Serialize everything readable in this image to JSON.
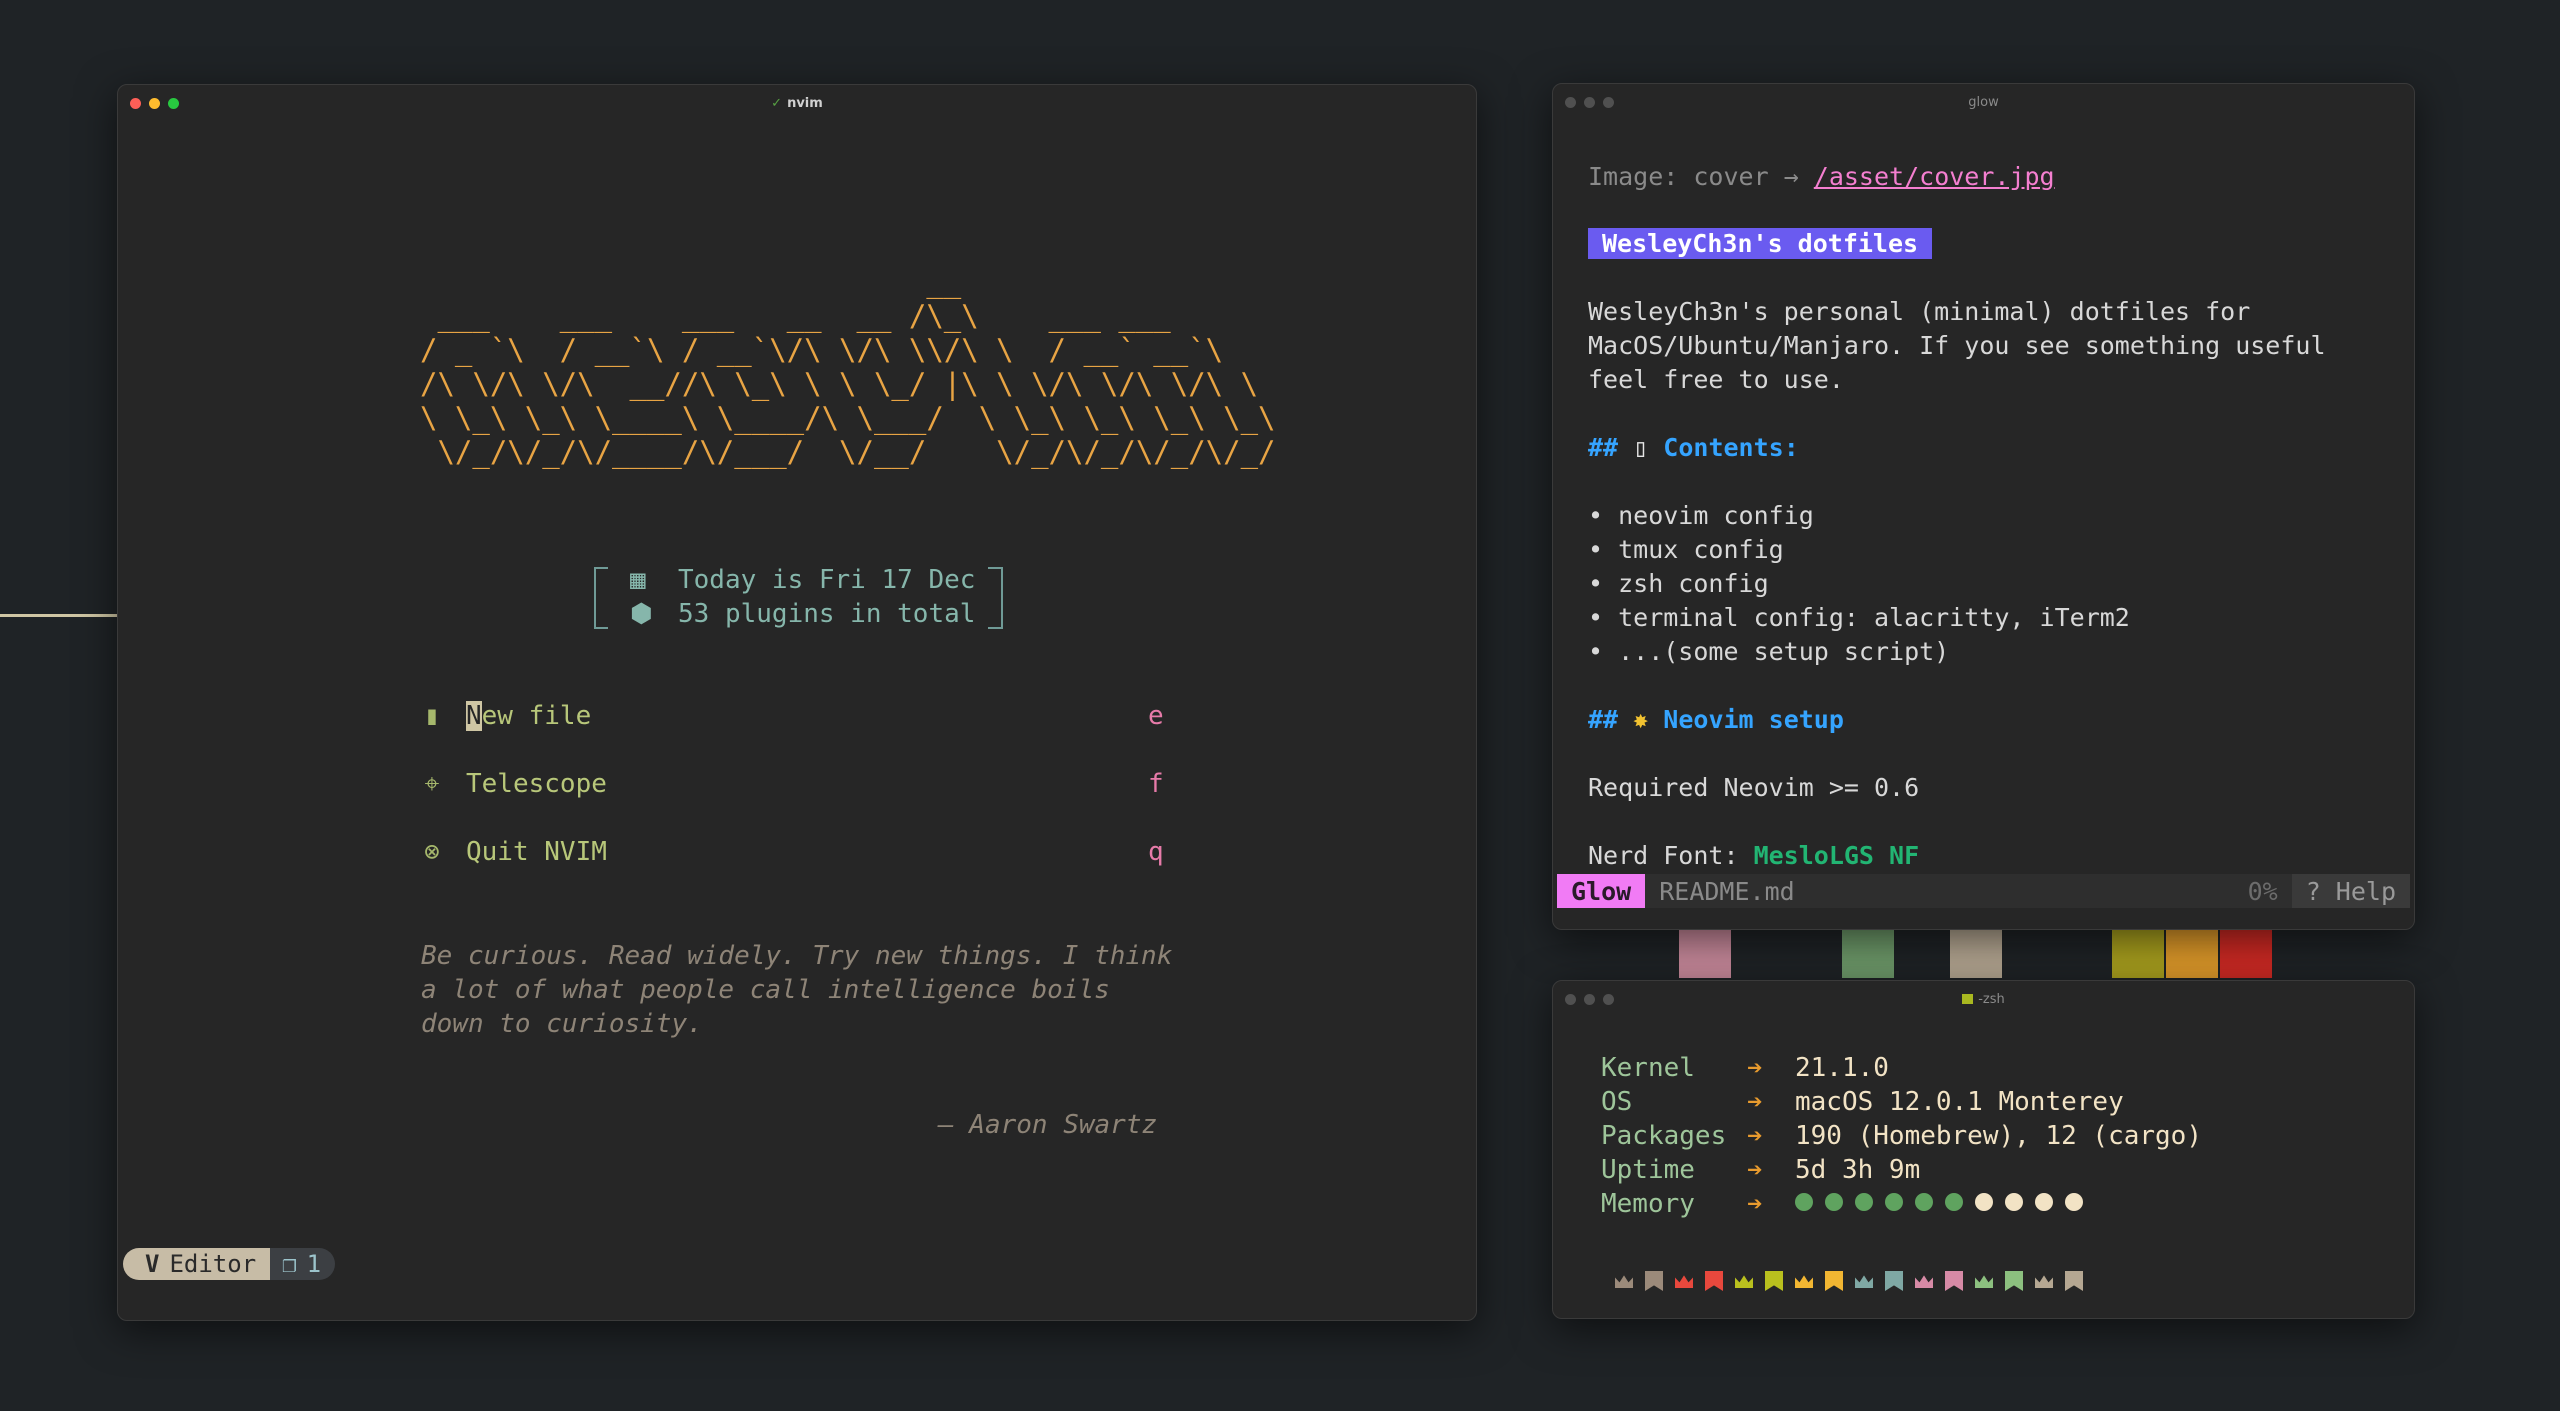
{
  "nvim": {
    "title": "nvim",
    "ascii_logo": "                             __\n ___    ___    ___   __  __ /\\_\\    ___ ___\n/ _ `\\  / __`\\ / __`\\/\\ \\/\\ \\\\/\\ \\  / __` __`\\\n/\\ \\/\\ \\/\\  __//\\ \\_\\ \\ \\ \\_/ |\\ \\ \\/\\ \\/\\ \\/\\ \\\n\\ \\_\\ \\_\\ \\____\\ \\____/\\ \\___/  \\ \\_\\ \\_\\ \\_\\ \\_\\\n \\/_/\\/_/\\/____/\\/___/  \\/__/    \\/_/\\/_/\\/_/\\/_/",
    "date_line": "Today is Fri 17 Dec",
    "plugins_line": "53 plugins in total",
    "menu": [
      {
        "icon": "file-icon",
        "label_rest": "ew file",
        "label_cursor": "N",
        "key": "e"
      },
      {
        "icon": "telescope-icon",
        "label": "Telescope",
        "key": "f"
      },
      {
        "icon": "quit-icon",
        "label": "Quit NVIM",
        "key": "q"
      }
    ],
    "quote": "Be curious. Read widely. Try new things. I think a lot of what people call intelligence boils down to curiosity.",
    "author": "– Aaron Swartz",
    "status_mode": "Editor",
    "status_tab_count": "1"
  },
  "glow": {
    "title": "glow",
    "image_line_prefix": "Image: cover → ",
    "image_link": "/asset/cover.jpg",
    "heading": "WesleyCh3n's dotfiles",
    "intro_1": "WesleyCh3n's personal (minimal) dotfiles for",
    "intro_2": "MacOS/Ubuntu/Manjaro. If you see something useful",
    "intro_3": "feel free to use.",
    "contents_hash": "##",
    "contents_title": "Contents:",
    "items": [
      "• neovim config",
      "• tmux config",
      "• zsh config",
      "• terminal config: alacritty, iTerm2",
      "• ...(some setup script)"
    ],
    "setup_hash": "##",
    "setup_title": "Neovim setup",
    "required_line": "Required Neovim >= 0.6",
    "nerd_prefix": "Nerd Font: ",
    "nerd_font": "MesloLGS NF",
    "status_app": "Glow",
    "status_file": "README.md",
    "status_pct": "0%",
    "status_help": "? Help"
  },
  "zsh": {
    "title": "-zsh",
    "rows": [
      {
        "label": "Kernel",
        "value": "21.1.0"
      },
      {
        "label": "OS",
        "value": "macOS 12.0.1 Monterey"
      },
      {
        "label": "Packages",
        "value": "190 (Homebrew), 12 (cargo)"
      },
      {
        "label": "Uptime",
        "value": "5d 3h 9m"
      },
      {
        "label": "Memory",
        "value": ""
      }
    ],
    "memory_used_dots": 6,
    "memory_total_dots": 10
  },
  "colors": {
    "accent_orange": "#e8a444",
    "glow_badge": "#f17bf5",
    "heading_badge": "#6a5bf0",
    "h2_blue": "#35a4ff",
    "memory_used": "#5fa35f",
    "memory_free": "#f2e3c5"
  }
}
